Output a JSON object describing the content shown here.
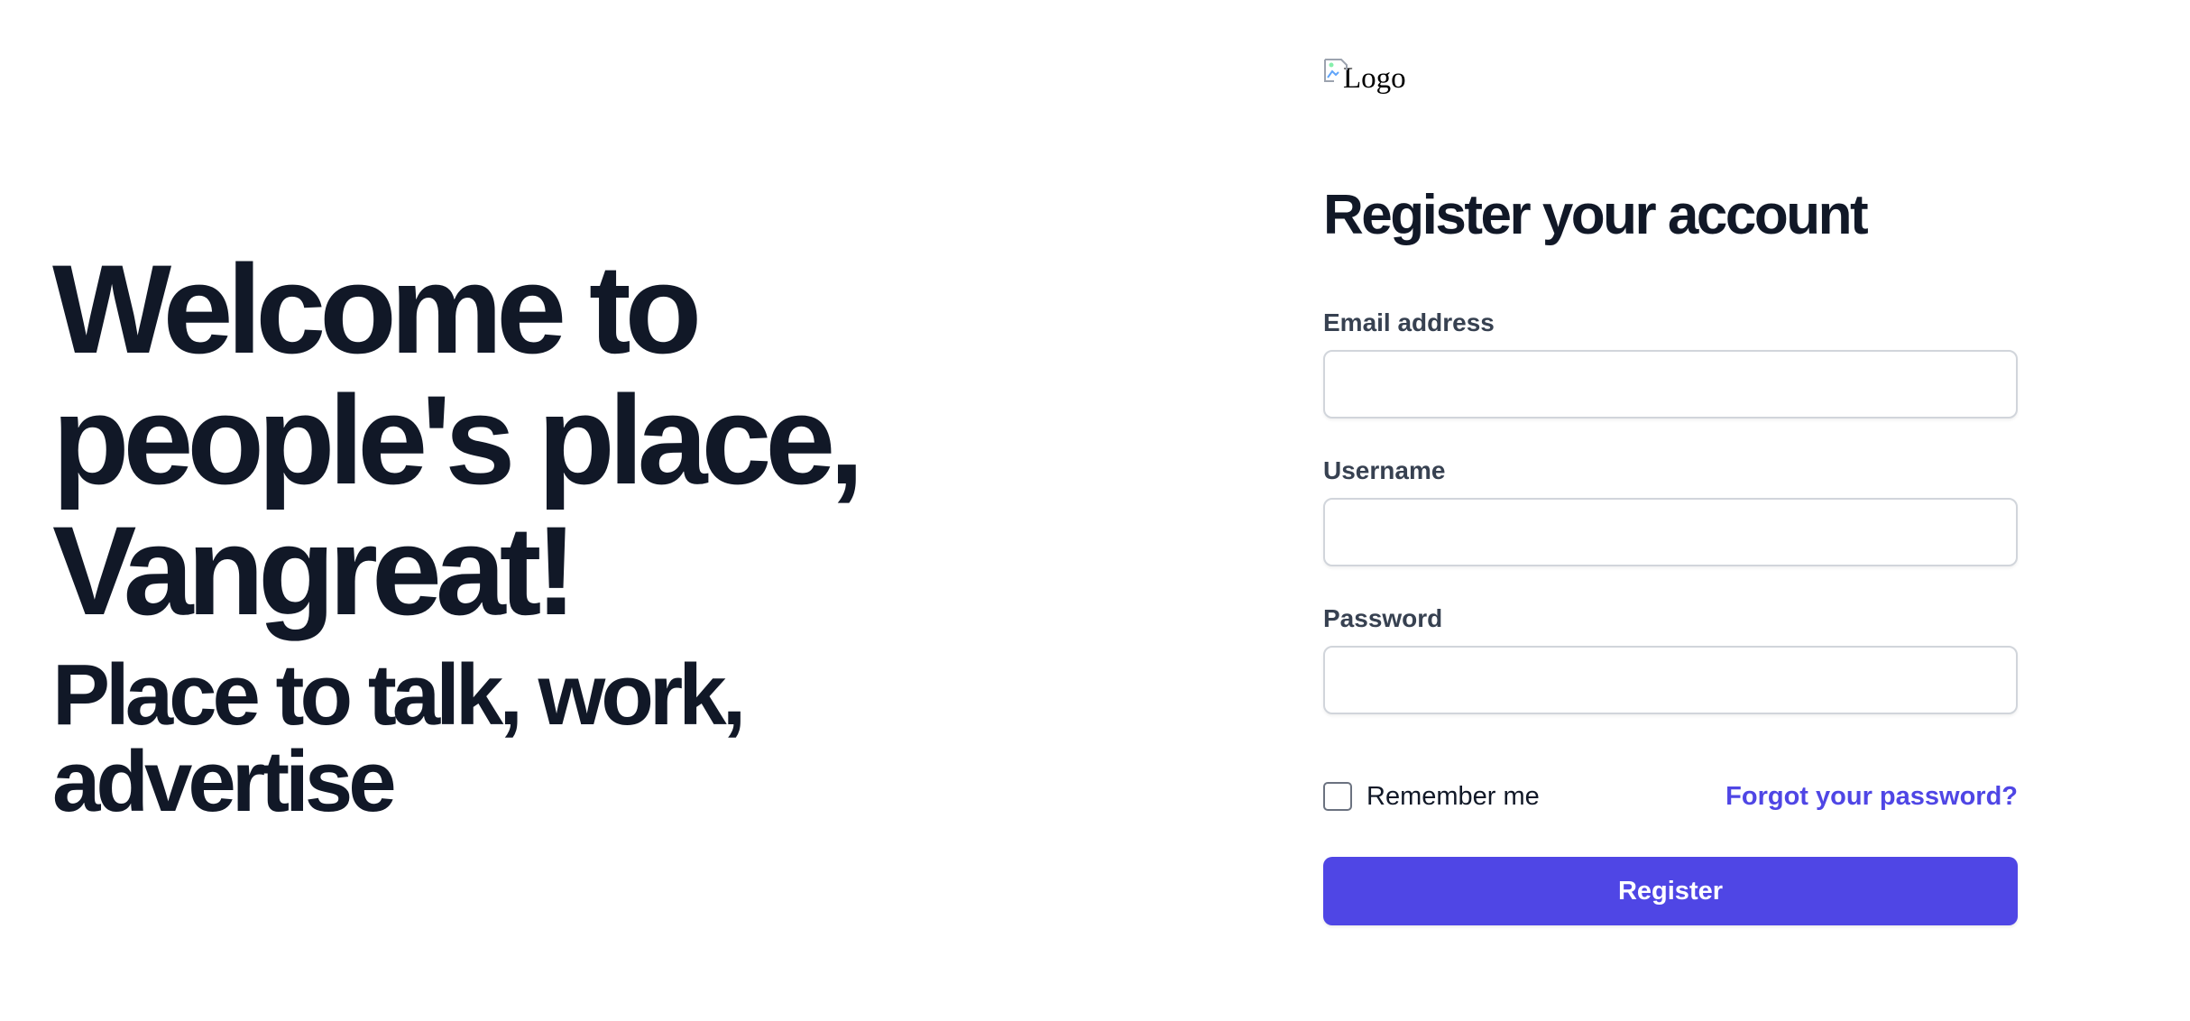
{
  "hero": {
    "title": "Welcome to people's place, Vangreat!",
    "subtitle": "Place to talk, work, advertise"
  },
  "logo": {
    "alt_text": "Logo",
    "icon": "broken-image-icon"
  },
  "form": {
    "title": "Register your account",
    "email": {
      "label": "Email address",
      "value": "",
      "placeholder": ""
    },
    "username": {
      "label": "Username",
      "value": "",
      "placeholder": ""
    },
    "password": {
      "label": "Password",
      "value": "",
      "placeholder": ""
    },
    "remember_label": "Remember me",
    "remember_checked": false,
    "forgot_label": "Forgot your password?",
    "submit_label": "Register"
  },
  "colors": {
    "text_primary": "#111827",
    "label": "#374151",
    "accent": "#4f46e5",
    "input_border": "#d1d5db"
  }
}
